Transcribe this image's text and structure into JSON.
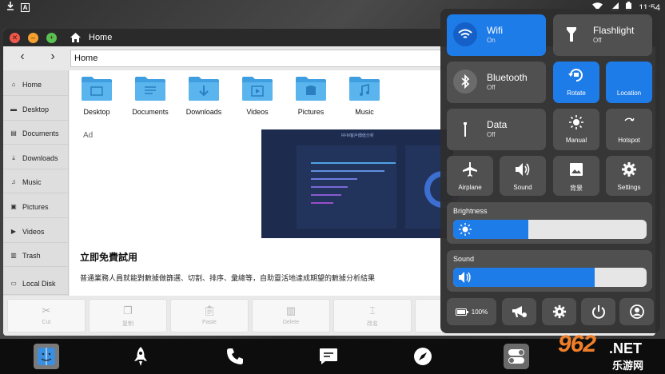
{
  "status_bar": {
    "time": "11:54",
    "icons": [
      "download-icon",
      "a-icon",
      "wifi-icon",
      "signal-icon",
      "battery-icon"
    ]
  },
  "window": {
    "title": "Home",
    "path": "Home",
    "sidebar": [
      {
        "label": "Home",
        "icon": "home-icon"
      },
      {
        "label": "Desktop",
        "icon": "desktop-icon"
      },
      {
        "label": "Documents",
        "icon": "documents-icon"
      },
      {
        "label": "Downloads",
        "icon": "download-icon"
      },
      {
        "label": "Music",
        "icon": "music-icon"
      },
      {
        "label": "Pictures",
        "icon": "pictures-icon"
      },
      {
        "label": "Videos",
        "icon": "videos-icon"
      },
      {
        "label": "Trash",
        "icon": "trash-icon"
      },
      {
        "label": "Local Disk",
        "icon": "disk-icon"
      }
    ],
    "folders": [
      {
        "label": "Desktop",
        "icon": "folder-desktop-icon"
      },
      {
        "label": "Documents",
        "icon": "folder-documents-icon"
      },
      {
        "label": "Downloads",
        "icon": "folder-downloads-icon"
      },
      {
        "label": "Videos",
        "icon": "folder-videos-icon"
      },
      {
        "label": "Pictures",
        "icon": "folder-pictures-icon"
      },
      {
        "label": "Music",
        "icon": "folder-music-icon"
      }
    ],
    "ad": {
      "label": "Ad",
      "image_title": "RFM客戶價值分析",
      "headline": "立即免費試用",
      "description": "普通業務人員就能對數據做篩選、切割、排序、彙總等，自助靈活地達成期望的數據分析結果"
    },
    "toolbar": [
      {
        "label": "Cut",
        "icon": "scissors-icon"
      },
      {
        "label": "复制",
        "icon": "copy-icon"
      },
      {
        "label": "Paste",
        "icon": "paste-icon"
      },
      {
        "label": "Delete",
        "icon": "trash-icon"
      },
      {
        "label": "改名",
        "icon": "rename-icon"
      }
    ]
  },
  "quick_settings": {
    "wifi": {
      "title": "Wifi",
      "state": "On"
    },
    "flashlight": {
      "title": "Flashlight",
      "state": "Off"
    },
    "bluetooth": {
      "title": "Bluetooth",
      "state": "Off"
    },
    "rotate": {
      "label": "Rotate"
    },
    "location": {
      "label": "Location"
    },
    "data": {
      "title": "Data",
      "state": "Off"
    },
    "manual": {
      "label": "Manual"
    },
    "hotspot": {
      "label": "Hotspot"
    },
    "airplane": {
      "label": "Airplane"
    },
    "sound_tile": {
      "label": "Sound"
    },
    "wallpaper": {
      "label": "背景"
    },
    "settings": {
      "label": "Settings"
    },
    "brightness": {
      "label": "Brightness",
      "level": 0.39
    },
    "volume": {
      "label": "Sound",
      "level": 0.73
    },
    "battery": {
      "value": "100%"
    }
  },
  "dock": [
    "finder-icon",
    "rocket-icon",
    "phone-icon",
    "message-icon",
    "compass-icon",
    "toggle-settings-icon"
  ],
  "watermark": {
    "number": "962",
    "suffix": ".NET",
    "sub": "乐游网"
  },
  "colors": {
    "accent": "#1e7ce8",
    "tile": "#505050",
    "panel": "#2e2e2e"
  }
}
